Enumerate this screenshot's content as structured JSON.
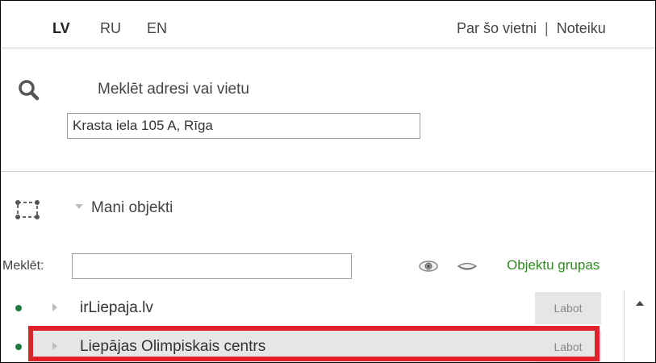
{
  "header": {
    "languages": [
      "LV",
      "RU",
      "EN"
    ],
    "active_language": "LV",
    "links": [
      "Par šo vietni",
      "Noteiku"
    ],
    "separator": "|"
  },
  "search": {
    "label": "Meklēt adresi vai vietu",
    "value": "Krasta iela 105 A, Rīga"
  },
  "objects": {
    "title": "Mani objekti",
    "filter_label": "Meklēt:",
    "filter_value": "",
    "groups_link": "Objektu grupas",
    "items": [
      {
        "name": "irLiepaja.lv",
        "edit_label": "Labot",
        "highlighted": false
      },
      {
        "name": "Liepājas Olimpiskais centrs",
        "edit_label": "Labot",
        "highlighted": true
      }
    ]
  },
  "colors": {
    "highlight": "#e3202a",
    "link_green": "#2e8b1f",
    "bullet": "#1f7a3d"
  }
}
